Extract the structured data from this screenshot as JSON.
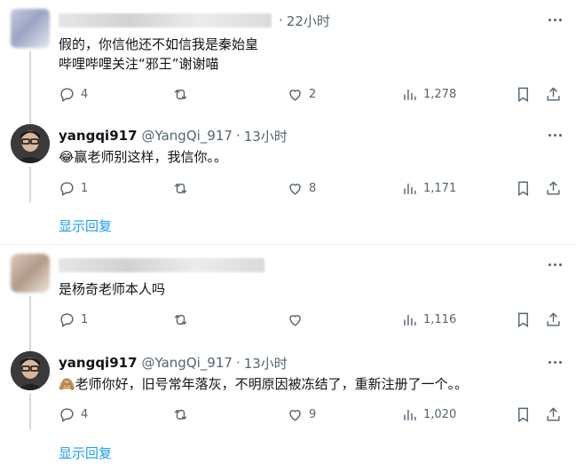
{
  "threads": [
    {
      "parent": {
        "time": "22小时",
        "text_lines": [
          "假的，你信他还不如信我是秦始皇",
          "哔哩哔哩关注“邪王”谢谢喵"
        ],
        "replies": "4",
        "reposts": "",
        "likes": "2",
        "views": "1,278"
      },
      "reply": {
        "name": "yangqi917",
        "handle": "@YangQi_917",
        "time": "13小时",
        "text": "😂赢老师别这样，我信你。。",
        "replies": "1",
        "reposts": "",
        "likes": "8",
        "views": "1,171"
      },
      "show_replies": "显示回复"
    },
    {
      "parent": {
        "time": "",
        "text_lines": [
          "是杨奇老师本人吗"
        ],
        "replies": "1",
        "reposts": "",
        "likes": "",
        "views": "1,116"
      },
      "reply": {
        "name": "yangqi917",
        "handle": "@YangQi_917",
        "time": "13小时",
        "text": "🙈老师你好，旧号常年落灰，不明原因被冻结了，重新注册了一个。。",
        "replies": "4",
        "reposts": "",
        "likes": "9",
        "views": "1,020"
      },
      "show_replies": "显示回复"
    }
  ],
  "icons": [
    "reply-icon",
    "repost-icon",
    "like-icon",
    "views-icon",
    "bookmark-icon",
    "share-icon",
    "more-icon"
  ],
  "colors": {
    "link": "#1d9bf0",
    "muted": "#536471",
    "text": "#0f1419",
    "thread_line": "#cfd9de"
  }
}
